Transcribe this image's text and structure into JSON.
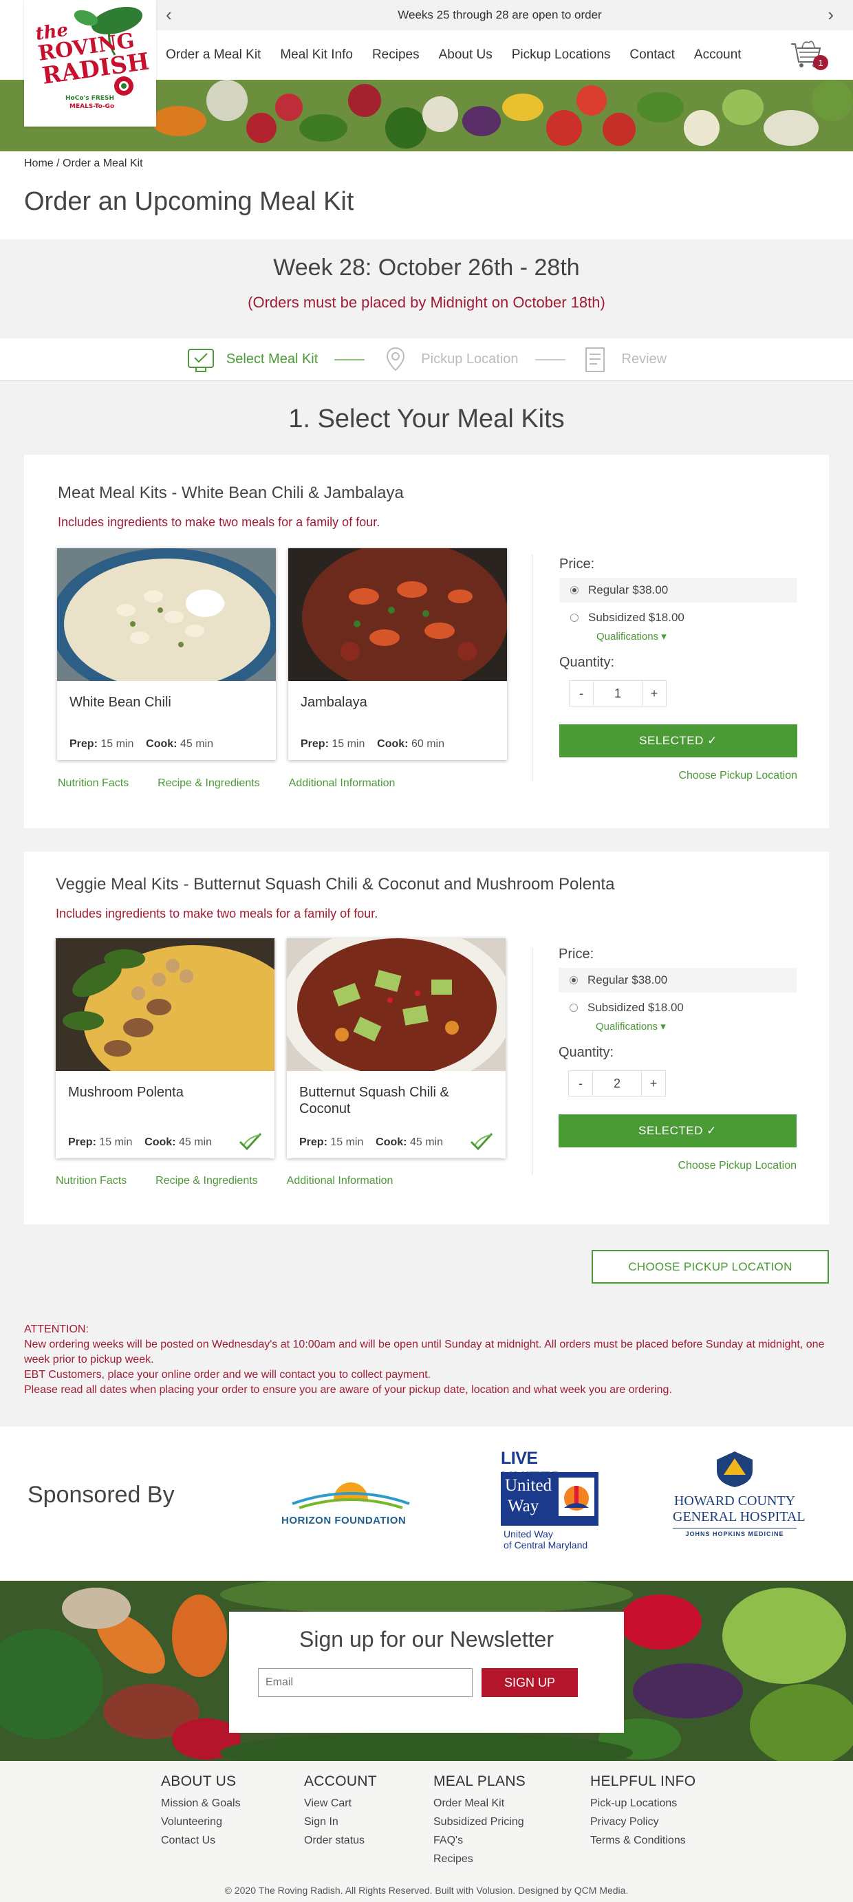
{
  "topbar": {
    "text": "Weeks 25 through 28 are open to order",
    "prev": "‹",
    "next": "›"
  },
  "logo": {
    "line1": "the",
    "line2": "ROVING",
    "line3": "RADISH",
    "tag": "HoCo's FRESH MEALS-To-Go"
  },
  "nav": {
    "items": [
      "Order a Meal Kit",
      "Meal Kit Info",
      "Recipes",
      "About Us",
      "Pickup Locations",
      "Contact",
      "Account"
    ],
    "cart_count": "1"
  },
  "breadcrumb": {
    "home": "Home",
    "sep": " / ",
    "current": "Order a Meal Kit"
  },
  "page_title": "Order an Upcoming Meal Kit",
  "week": {
    "title": "Week 28: October 26th - 28th",
    "deadline": "(Orders must be placed by Midnight on October 18th)"
  },
  "steps": [
    {
      "label": "Select Meal Kit"
    },
    {
      "label": "Pickup Location"
    },
    {
      "label": "Review"
    }
  ],
  "section_title": "1. Select Your Meal Kits",
  "cards": [
    {
      "title": "Meat Meal Kits - White Bean Chili & Jambalaya",
      "subtitle": "Includes ingredients to make two meals for a family of four.",
      "kits": [
        {
          "name": "White Bean Chili",
          "prep_label": "Prep:",
          "prep": "15 min",
          "cook_label": "Cook:",
          "cook": "45 min"
        },
        {
          "name": "Jambalaya",
          "prep_label": "Prep:",
          "prep": "15 min",
          "cook_label": "Cook:",
          "cook": "60 min"
        }
      ],
      "links": [
        "Nutrition Facts",
        "Recipe & Ingredients",
        "Additional Information"
      ],
      "price_label": "Price:",
      "regular": "Regular $38.00",
      "subsidized": "Subsidized $18.00",
      "qualifications": "Qualifications ▾",
      "qty_label": "Quantity:",
      "qty": "1",
      "minus": "-",
      "plus": "+",
      "button": "SELECTED ✓",
      "choose": "Choose Pickup Location"
    },
    {
      "title": "Veggie Meal Kits - Butternut Squash Chili & Coconut and Mushroom Polenta",
      "subtitle": "Includes ingredients to make two meals for a family of four.",
      "kits": [
        {
          "name": "Mushroom Polenta",
          "prep_label": "Prep:",
          "prep": "15 min",
          "cook_label": "Cook:",
          "cook": "45 min"
        },
        {
          "name": "Butternut Squash Chili & Coconut",
          "prep_label": "Prep:",
          "prep": "15 min",
          "cook_label": "Cook:",
          "cook": "45 min"
        }
      ],
      "links": [
        "Nutrition Facts",
        "Recipe & Ingredients",
        "Additional Information"
      ],
      "price_label": "Price:",
      "regular": "Regular $38.00",
      "subsidized": "Subsidized $18.00",
      "qualifications": "Qualifications ▾",
      "qty_label": "Quantity:",
      "qty": "2",
      "minus": "-",
      "plus": "+",
      "button": "SELECTED ✓",
      "choose": "Choose Pickup Location"
    }
  ],
  "choose_button": "CHOOSE PICKUP LOCATION",
  "attention": [
    "ATTENTION:",
    "New ordering weeks will be posted on Wednesday's at 10:00am and will be open until Sunday at midnight. All orders must be placed before Sunday at midnight, one week prior to pickup week.",
    "EBT Customers, place your online order and we will contact you to collect payment.",
    "Please read all dates when placing your order to ensure you are aware of your pickup date, location and what week you are ordering."
  ],
  "sponsors": {
    "title": "Sponsored By",
    "horizon": "HORIZON FOUNDATION",
    "uw_top": "LIVE UNITED",
    "uw_1": "United",
    "uw_2": "Way",
    "uw_sub1": "United Way",
    "uw_sub2": "of Central Maryland",
    "hc_1": "HOWARD COUNTY",
    "hc_2": "GENERAL HOSPITAL",
    "hc_3": "JOHNS HOPKINS MEDICINE"
  },
  "newsletter": {
    "title": "Sign up for our Newsletter",
    "placeholder": "Email",
    "button": "SIGN UP"
  },
  "footer": {
    "cols": [
      {
        "heading": "ABOUT US",
        "links": [
          "Mission & Goals",
          "Volunteering",
          "Contact Us"
        ]
      },
      {
        "heading": "ACCOUNT",
        "links": [
          "View Cart",
          "Sign In",
          "Order status"
        ]
      },
      {
        "heading": "MEAL PLANS",
        "links": [
          "Order Meal Kit",
          "Subsidized Pricing",
          "FAQ's",
          "Recipes"
        ]
      },
      {
        "heading": "HELPFUL INFO",
        "links": [
          "Pick-up Locations",
          "Privacy Policy",
          "Terms & Conditions"
        ]
      }
    ],
    "copyright": "© 2020 The Roving Radish. All Rights Reserved. Built with Volusion. Designed by QCM Media."
  },
  "colors": {
    "green": "#4a9a36",
    "red": "#a31b34",
    "grey_bg": "#f2f2f2"
  }
}
